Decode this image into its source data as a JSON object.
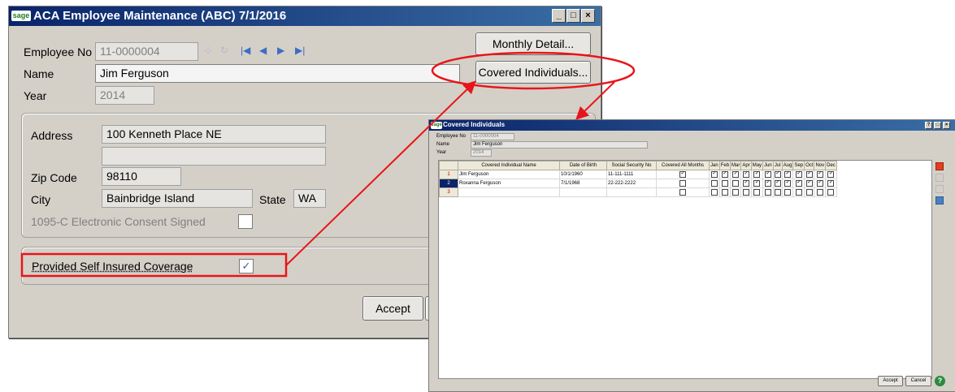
{
  "main": {
    "title": "ACA Employee Maintenance (ABC) 7/1/2016",
    "logo": "sage",
    "employee_no_label": "Employee No",
    "employee_no": "11-0000004",
    "name_label": "Name",
    "name": "Jim Ferguson",
    "year_label": "Year",
    "year": "2014",
    "address_label": "Address",
    "address1": "100 Kenneth Place NE",
    "address2": "",
    "zip_label": "Zip Code",
    "zip": "98110",
    "city_label": "City",
    "city": "Bainbridge Island",
    "state_label": "State",
    "state": "WA",
    "consent_label": "1095-C Electronic Consent Signed",
    "self_insured_label": "Provided Self Insured Coverage",
    "monthly_detail": "Monthly Detail...",
    "covered_individuals": "Covered Individuals...",
    "accept": "Accept",
    "win_buttons": [
      "_",
      "□",
      "×"
    ]
  },
  "covered": {
    "title": "Covered Individuals",
    "employee_no_label": "Employee No",
    "employee_no": "11-0000004",
    "name_label": "Name",
    "name": "Jim Ferguson",
    "year_label": "Year",
    "year": "2014",
    "columns": [
      "Covered Individual Name",
      "Date of Birth",
      "Social Security No",
      "Covered All Months"
    ],
    "months": [
      "Jan",
      "Feb",
      "Mar",
      "Apr",
      "May",
      "Jun",
      "Jul",
      "Aug",
      "Sep",
      "Oct",
      "Nov",
      "Dec"
    ],
    "rows": [
      {
        "num": "1",
        "name": "Jim Ferguson",
        "dob": "10/1/1960",
        "ssn": "11-111-1111",
        "all": true,
        "months": [
          true,
          true,
          true,
          true,
          true,
          true,
          true,
          true,
          true,
          true,
          true,
          true
        ]
      },
      {
        "num": "2",
        "name": "Roxanna Ferguson",
        "dob": "7/1/1968",
        "ssn": "22-222-2222",
        "all": false,
        "months": [
          false,
          false,
          false,
          true,
          true,
          true,
          true,
          true,
          true,
          true,
          true,
          true
        ]
      },
      {
        "num": "3",
        "name": "",
        "dob": "",
        "ssn": "",
        "all": false,
        "months": [
          false,
          false,
          false,
          false,
          false,
          false,
          false,
          false,
          false,
          false,
          false,
          false
        ]
      }
    ],
    "accept": "Accept",
    "cancel": "Cancel",
    "help": "?"
  },
  "annotation_color": "#e8141a"
}
